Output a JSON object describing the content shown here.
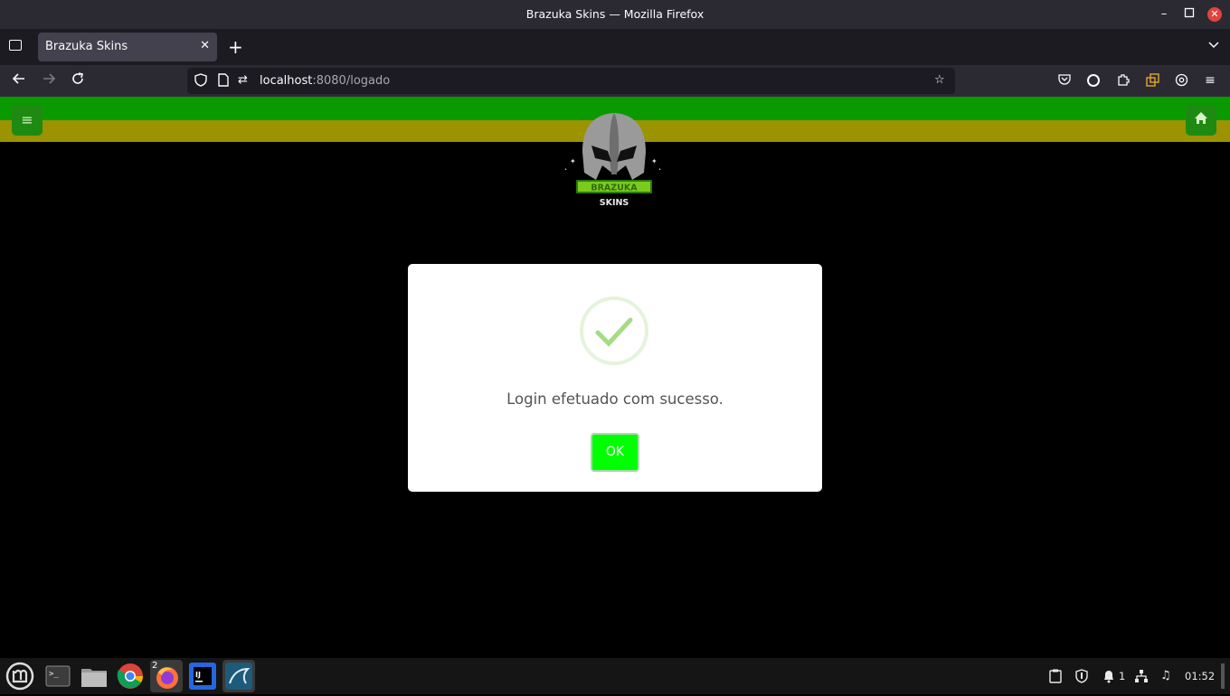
{
  "window": {
    "title": "Brazuka Skins — Mozilla Firefox"
  },
  "tabs": [
    {
      "label": "Brazuka Skins",
      "close": "✕"
    }
  ],
  "newtab_label": "+",
  "address": {
    "host": "localhost",
    "path": ":8080/logado"
  },
  "page": {
    "logo_text_top": "BRAZUKA",
    "logo_text_bottom": "SKINS"
  },
  "modal": {
    "message": "Login efetuado com sucesso.",
    "ok_label": "OK"
  },
  "taskbar": {
    "firefox_badge": "2",
    "notification_count": "1",
    "clock": "01:52"
  },
  "colors": {
    "stripe_green": "#0a9a00",
    "stripe_olive": "#9b9300",
    "ok_button": "#00ff00",
    "check_color": "#a5dc86"
  }
}
